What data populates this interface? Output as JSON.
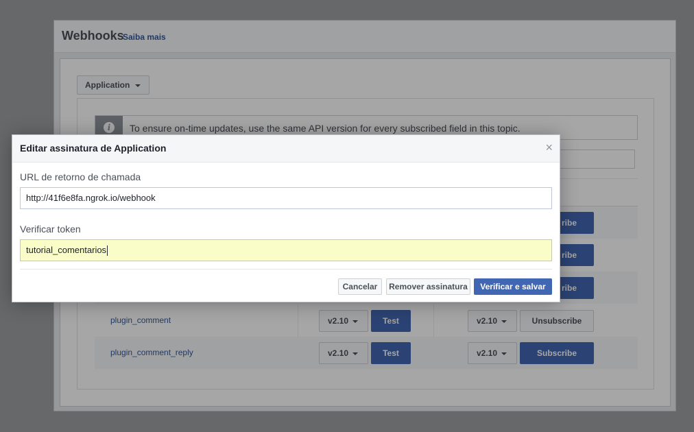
{
  "page": {
    "title": "Webhooks",
    "learn_more": "Saiba mais",
    "object_select": "Application",
    "info_text": "To ensure on-time updates, use the same API version for every subscribed field in this topic.",
    "rows": [
      {
        "field": "plugin_comment",
        "test_version": "v2.10",
        "test_label": "Test",
        "sub_version": "v2.10",
        "sub_label": "Unsubscribe"
      },
      {
        "field": "plugin_comment_reply",
        "test_version": "v2.10",
        "test_label": "Test",
        "sub_version": "v2.10",
        "sub_label": "Subscribe"
      }
    ],
    "hidden_rows_labels": [
      "ribe",
      "ribe",
      "ribe"
    ]
  },
  "modal": {
    "title": "Editar assinatura de Application",
    "close_glyph": "×",
    "callback_label": "URL de retorno de chamada",
    "callback_value": "http://41f6e8fa.ngrok.io/webhook",
    "token_label": "Verificar token",
    "token_value": "tutorial_comentarios",
    "cancel_label": "Cancelar",
    "remove_label": "Remover assinatura",
    "save_label": "Verificar e salvar"
  },
  "colors": {
    "accent": "#4267b2",
    "link": "#365899",
    "autofill": "#fafdc7"
  },
  "icons": [
    "info-icon",
    "chevron-down-icon",
    "close-icon"
  ]
}
